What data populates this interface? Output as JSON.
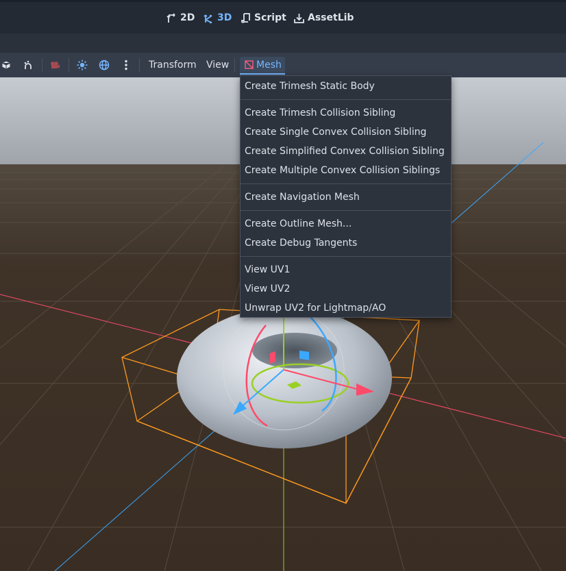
{
  "workspaces": {
    "items": [
      {
        "label": "2D",
        "icon": "2d-icon"
      },
      {
        "label": "3D",
        "icon": "3d-icon",
        "active": true
      },
      {
        "label": "Script",
        "icon": "script-icon"
      },
      {
        "label": "AssetLib",
        "icon": "assetlib-icon"
      }
    ]
  },
  "toolbar": {
    "transform_label": "Transform",
    "view_label": "View",
    "mesh_label": "Mesh"
  },
  "mesh_menu": {
    "items": [
      "Create Trimesh Static Body",
      "Create Trimesh Collision Sibling",
      "Create Single Convex Collision Sibling",
      "Create Simplified Convex Collision Sibling",
      "Create Multiple Convex Collision Siblings",
      "Create Navigation Mesh",
      "Create Outline Mesh...",
      "Create Debug Tangents",
      "View UV1",
      "View UV2",
      "Unwrap UV2 for Lightmap/AO"
    ]
  },
  "colors": {
    "accent": "#74b6ff",
    "editor_bg": "#232a33",
    "toolbar_bg": "#363d4a",
    "menu_bg": "#2d333d",
    "ground": "#3b2f26",
    "sky": "#b8bec6",
    "selection_box": "#ff9a1f",
    "axis_x": "#ff4a6a",
    "axis_y": "#9ad025",
    "axis_z": "#3aa8ff"
  }
}
